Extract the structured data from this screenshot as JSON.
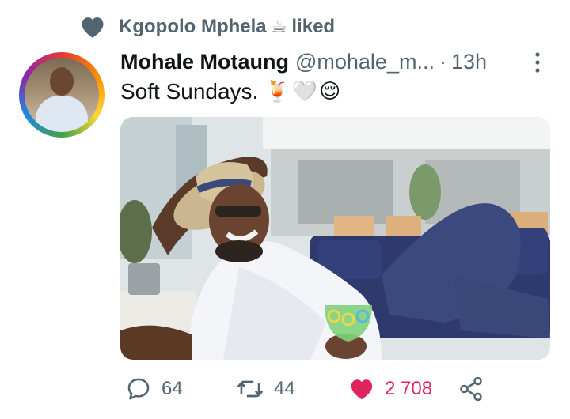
{
  "social_context": {
    "liker_name": "Kgopolo Mphela",
    "liker_emoji": "☕",
    "action": "liked",
    "icon": "heart-icon"
  },
  "tweet": {
    "author_name": "Mohale Motaung",
    "handle": "@mohale_m...",
    "separator": "·",
    "time": "13h",
    "text": "Soft Sundays.",
    "text_emojis": "🍹🤍😌",
    "more_icon": "more-vertical-icon",
    "media_icon": "photo"
  },
  "actions": {
    "reply_count": "64",
    "retweet_count": "44",
    "like_count": "2 708",
    "like_color": "#e0245e",
    "muted_color": "#536471"
  }
}
